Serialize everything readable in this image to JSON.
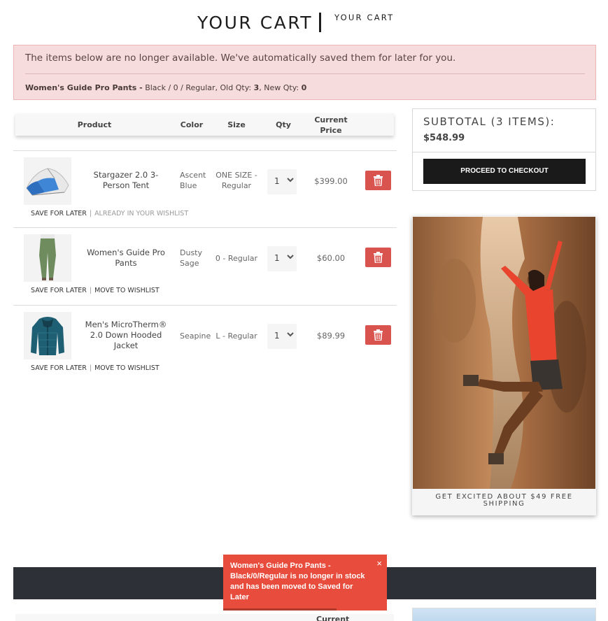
{
  "page": {
    "title": "YOUR CART",
    "subtitle": "YOUR CART"
  },
  "alert": {
    "message": "The items below are no longer available. We've automatically saved them for later for you.",
    "item_name": "Women's Guide Pro Pants -",
    "details_text": "Black / 0 / Regular, Old Qty:",
    "old_qty": "3",
    "new_qty_label": ", New Qty:",
    "new_qty": "0"
  },
  "table": {
    "headers": {
      "product": "Product",
      "color": "Color",
      "size": "Size",
      "qty": "Qty",
      "price_line1": "Current",
      "price_line2": "Price"
    }
  },
  "items": [
    {
      "name_line1": "Stargazer 2.0 3-",
      "name_line2": "Person Tent",
      "color_line1": "Ascent",
      "color_line2": "Blue",
      "size_line1": "ONE SIZE -",
      "size_line2": "Regular",
      "qty": "1",
      "price": "$399.00",
      "action1": "SAVE FOR LATER",
      "action2": "ALREADY IN YOUR WISHLIST",
      "thumb_icon": "tent-image"
    },
    {
      "name_line1": "Women's Guide Pro",
      "name_line2": "Pants",
      "color_line1": "Dusty",
      "color_line2": "Sage",
      "size_line1": "0 - Regular",
      "qty": "1",
      "price": "$60.00",
      "action1": "SAVE FOR LATER",
      "action2": "MOVE TO WISHLIST",
      "thumb_icon": "pants-image"
    },
    {
      "name_line1": "Men's MicroTherm®",
      "name_line2": "2.0 Down Hooded",
      "name_line3": "Jacket",
      "color_line1": "Seapine",
      "size_line1": "L - Regular",
      "qty": "1",
      "price": "$89.99",
      "action1": "SAVE FOR LATER",
      "action2": "MOVE TO WISHLIST",
      "thumb_icon": "jacket-image"
    }
  ],
  "summary": {
    "label": "SUBTOTAL (3 ITEMS):",
    "total": "$548.99",
    "checkout_label": "PROCEED TO CHECKOUT"
  },
  "promo": {
    "caption_line1": "GET EXCITED ABOUT $49 FREE",
    "caption_line2": "SHIPPING"
  },
  "second_table": {
    "header_partial": "Current"
  },
  "toast": {
    "message_line1": "Women's Guide Pro Pants -",
    "message_line2": "Black/0/Regular is no longer in stock",
    "message_line3": "and has been moved to Saved for",
    "message_line4": "Later",
    "close": "×"
  },
  "colors": {
    "alert_bg": "#f6dcdc",
    "trash_button": "#d9534f",
    "checkout_button": "#1a1a1a",
    "toast_bg": "#e74c3c",
    "dark_bar": "#2d3036"
  }
}
